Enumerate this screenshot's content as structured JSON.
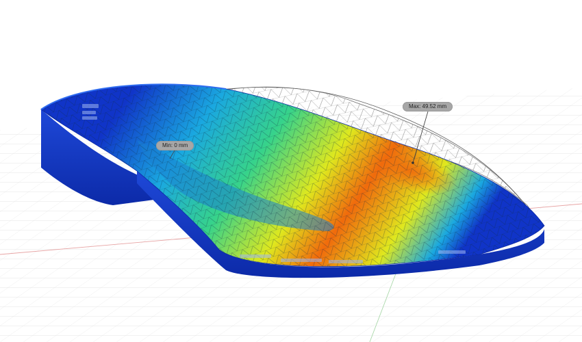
{
  "viewport": {
    "type": "3d-simulation-displacement-plot",
    "background": "#ffffff",
    "grid_color": "#d6d6d6",
    "x_axis_color": "#e7a3a3",
    "y_axis_color": "#a9d8a9"
  },
  "probes": {
    "min": {
      "label": "Min: 0 mm"
    },
    "max": {
      "label": "Max: 49.52 mm"
    }
  },
  "legend_colors": {
    "low": "#1034c8",
    "mid_low": "#1aa8e0",
    "mid": "#37d38a",
    "mid_high": "#dfe81e",
    "high": "#f06a0c"
  },
  "icons": {
    "mesh_overlay": "wireframe-mesh-icon",
    "deformed_outline": "undeformed-wireframe-icon"
  }
}
